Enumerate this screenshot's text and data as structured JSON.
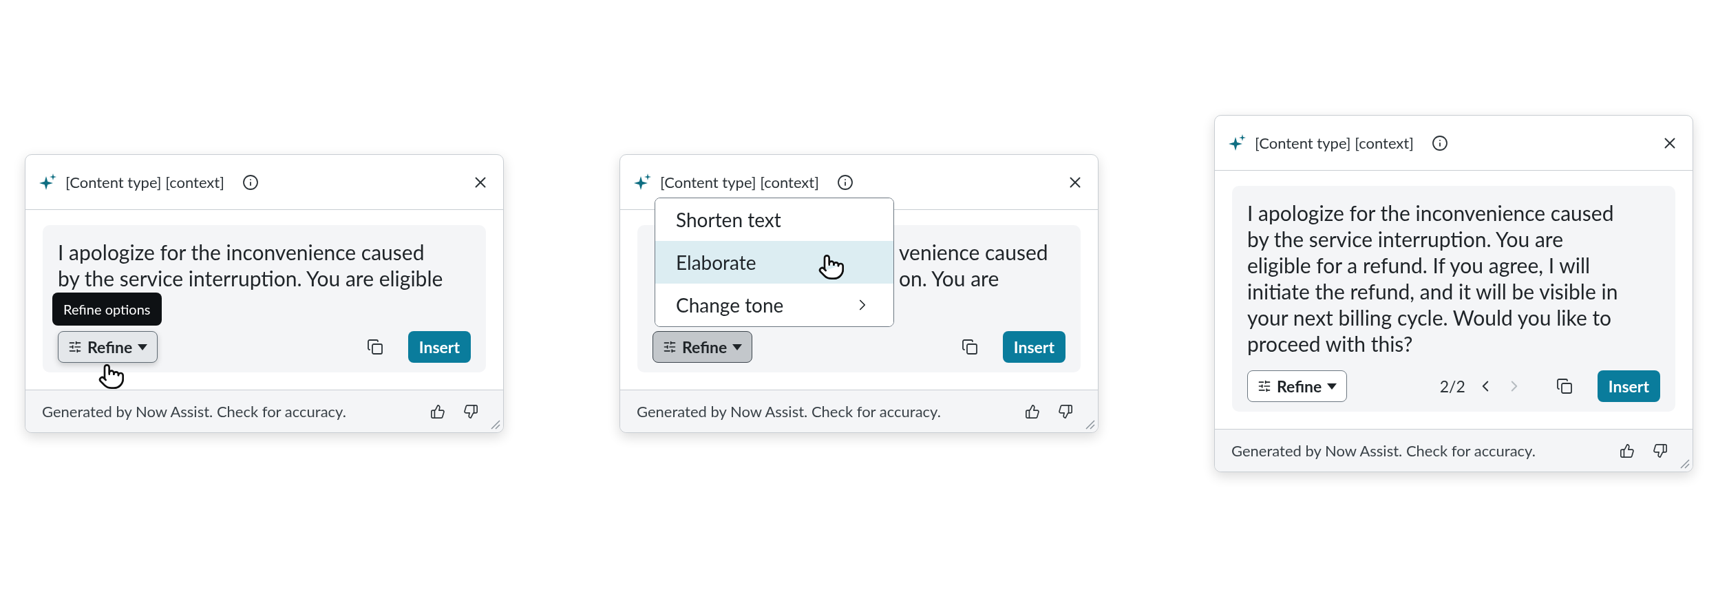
{
  "cards": [
    {
      "kind": "tooltip",
      "title": "[Content type] [context]",
      "message": {
        "lines": [
          "I apologize for the inconvenience caused",
          "by the service interruption. You are eligible"
        ]
      },
      "tooltip": "Refine options",
      "refine": {
        "label": "Refine",
        "hovered": true,
        "pressed": false
      },
      "insert": "Insert",
      "footer": "Generated by Now Assist. Check for accuracy."
    },
    {
      "kind": "menu",
      "title": "[Content type] [context]",
      "message": {
        "lines": [
          "venience caused",
          "on. You are"
        ]
      },
      "menu": [
        {
          "label": "Shorten text",
          "selected": false,
          "submenu": false
        },
        {
          "label": "Elaborate",
          "selected": true,
          "submenu": false
        },
        {
          "label": "Change tone",
          "selected": false,
          "submenu": true
        }
      ],
      "refine": {
        "label": "Refine",
        "hovered": false,
        "pressed": true
      },
      "insert": "Insert",
      "footer": "Generated by Now Assist. Check for accuracy."
    },
    {
      "kind": "paged",
      "title": "[Content type] [context]",
      "message": {
        "text": "I apologize for the inconvenience caused by the service interruption. You are eligible for a refund. If you agree, I will initiate the refund, and it will be visible in your next billing cycle. Would you like to proceed with this?"
      },
      "refine": {
        "label": "Refine",
        "hovered": false,
        "pressed": false
      },
      "pager": {
        "label": "2/2",
        "prev_disabled": false,
        "next_disabled": true
      },
      "insert": "Insert",
      "footer": "Generated by Now Assist. Check for accuracy."
    }
  ]
}
